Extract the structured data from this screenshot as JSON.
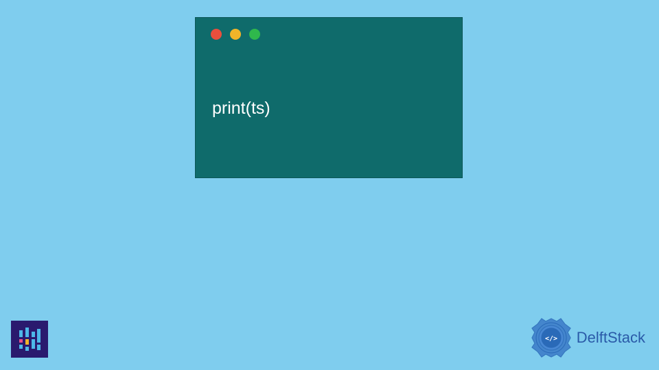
{
  "terminal": {
    "code": "print(ts)",
    "dots": {
      "red": "#e94f3d",
      "yellow": "#f0b429",
      "green": "#2fb84c"
    }
  },
  "brand": {
    "name": "DelftStack"
  }
}
